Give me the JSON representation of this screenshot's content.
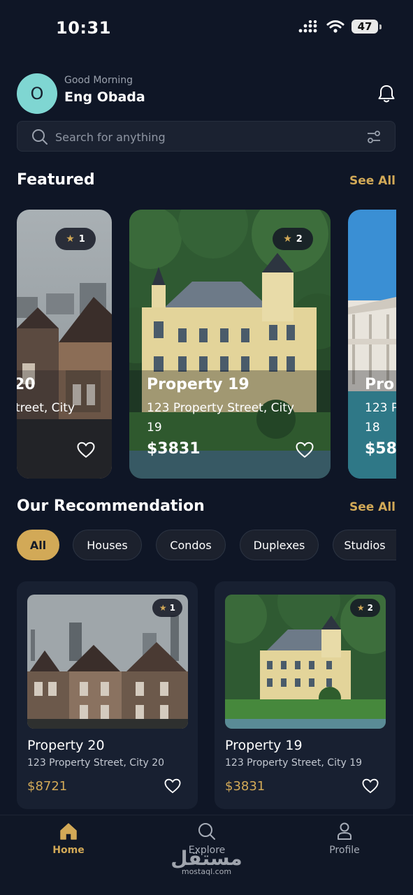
{
  "status_bar": {
    "time": "10:31",
    "battery": "47"
  },
  "header": {
    "avatar_initial": "O",
    "greeting": "Good Morning",
    "user_name": "Eng Obada"
  },
  "search": {
    "placeholder": "Search for anything"
  },
  "featured": {
    "title": "Featured",
    "see_all": "See All",
    "cards": [
      {
        "rank": "1",
        "title": "20",
        "address": "treet, City",
        "price": ""
      },
      {
        "rank": "2",
        "title": "Property 19",
        "address_line1": "123 Property Street, City",
        "address_line2": "19",
        "price": "$3831"
      },
      {
        "rank": "",
        "title": "Pro",
        "address_line1": "123 P",
        "address_line2": "18",
        "price": "$58"
      }
    ]
  },
  "recommendation": {
    "title": "Our Recommendation",
    "see_all": "See All",
    "filters": [
      "All",
      "Houses",
      "Condos",
      "Duplexes",
      "Studios"
    ],
    "active_filter": "All",
    "cards": [
      {
        "rank": "1",
        "title": "Property 20",
        "address": "123 Property Street, City 20",
        "price": "$8721"
      },
      {
        "rank": "2",
        "title": "Property 19",
        "address": "123 Property Street, City 19",
        "price": "$3831"
      }
    ]
  },
  "nav": {
    "items": [
      {
        "label": "Home",
        "icon": "home-icon",
        "active": true
      },
      {
        "label": "Explore",
        "icon": "search-icon"
      },
      {
        "label": "Profile",
        "icon": "user-icon"
      }
    ]
  },
  "watermark": {
    "arabic": "مستقل",
    "site": "mostaql.com"
  },
  "colors": {
    "background": "#0f1626",
    "accent": "#d2a957",
    "card": "#182031",
    "avatar": "#7fd6d2"
  }
}
